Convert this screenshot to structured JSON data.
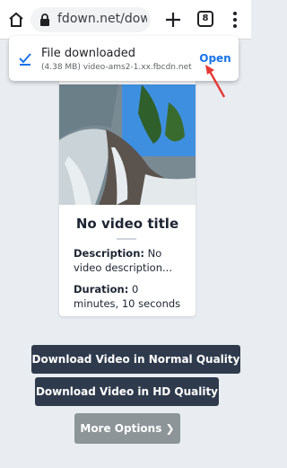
{
  "browser": {
    "url": "fdown.net/downl",
    "tab_count": "8"
  },
  "download_popup": {
    "title": "File downloaded",
    "subtitle": "(4.38 MB) video-ams2-1.xx.fbcdn.net",
    "open_label": "Open"
  },
  "video": {
    "title": "No video title",
    "description_label": "Description:",
    "description_value": "No video description...",
    "duration_label": "Duration:",
    "duration_value": "0 minutes, 10 seconds"
  },
  "buttons": {
    "normal_quality": "Download Video in Normal Quality",
    "hd_quality": "Download Video in HD Quality",
    "more_options": "More Options ❯"
  },
  "colors": {
    "accent": "#1a73e8",
    "button_dark": "#2f3b4d",
    "button_muted": "#8d9599",
    "annotation_arrow": "#e53935"
  }
}
